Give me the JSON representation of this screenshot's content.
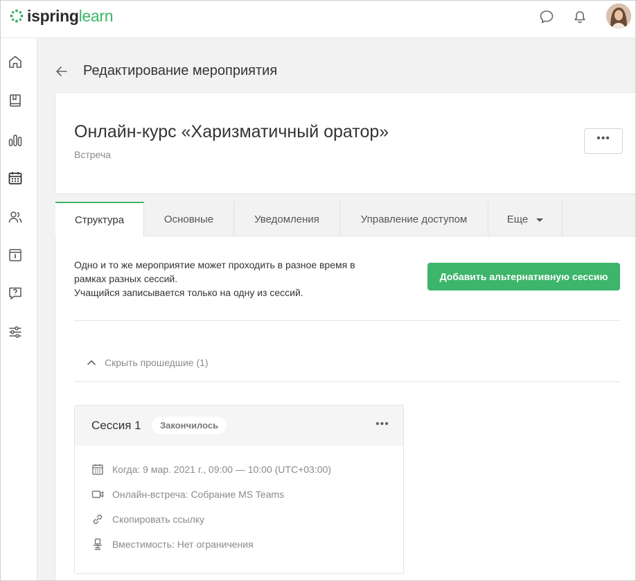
{
  "app": {
    "logo_part1": "ispring",
    "logo_part2": "learn"
  },
  "header": {
    "icons": [
      "chat-icon",
      "bell-icon"
    ],
    "avatar": "user-avatar"
  },
  "sidebar": {
    "items": [
      "home-icon",
      "book-icon",
      "stats-icon",
      "calendar-icon",
      "users-icon",
      "info-icon",
      "question-icon",
      "settings-sliders-icon"
    ]
  },
  "page": {
    "title": "Редактирование мероприятия"
  },
  "event": {
    "title": "Онлайн-курс «Харизматичный оратор»",
    "type": "Встреча",
    "more_label": "•••"
  },
  "tabs": [
    {
      "label": "Структура",
      "active": true
    },
    {
      "label": "Основные"
    },
    {
      "label": "Уведомления"
    },
    {
      "label": "Управление доступом"
    },
    {
      "label": "Еще"
    }
  ],
  "structure": {
    "description_lines": [
      "Одно и то же мероприятие может проходить в разное время в",
      "рамках разных сессий.",
      "Учащийся записывается только на одну из сессий."
    ],
    "add_button": "Добавить альтернативную сессию",
    "hide_past": "Скрыть прошедшие (1)"
  },
  "session": {
    "name": "Сессия 1",
    "status": "Закончилось",
    "more_label": "•••",
    "when": "Когда: 9 мар. 2021 г., 09:00 — 10:00 (UTC+03:00)",
    "meeting": "Онлайн-встреча: Собрание MS Teams",
    "copy_link": "Скопировать ссылку",
    "capacity": "Вместимость: Нет ограничения"
  },
  "colors": {
    "accent": "#3db56a",
    "background": "#f2f2f2"
  }
}
